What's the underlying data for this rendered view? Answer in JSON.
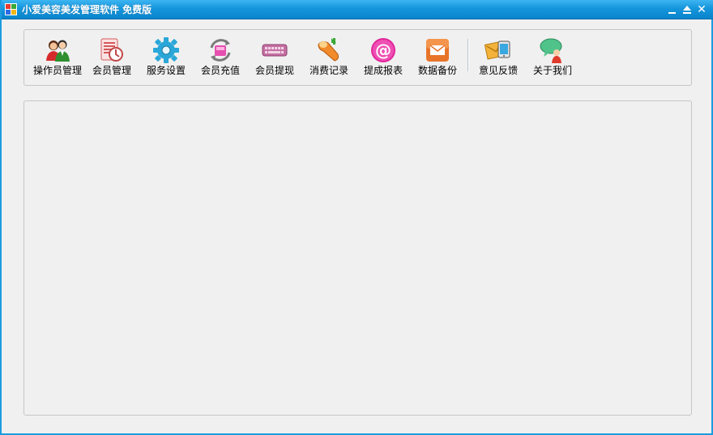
{
  "window": {
    "title": "小爱美容美发管理软件 免费版",
    "controls": {
      "minimize": "_",
      "maximize": "▲",
      "close": "✕"
    }
  },
  "toolbar": {
    "items": [
      {
        "label": "操作员管理",
        "icon": "operators-icon"
      },
      {
        "label": "会员管理",
        "icon": "member-card-icon"
      },
      {
        "label": "服务设置",
        "icon": "gear-icon"
      },
      {
        "label": "会员充值",
        "icon": "recharge-icon"
      },
      {
        "label": "会员提现",
        "icon": "keyboard-icon"
      },
      {
        "label": "消费记录",
        "icon": "record-icon"
      },
      {
        "label": "提成报表",
        "icon": "at-sign-icon"
      },
      {
        "label": "数据备份",
        "icon": "mail-icon"
      },
      {
        "label": "意见反馈",
        "icon": "feedback-icon"
      },
      {
        "label": "关于我们",
        "icon": "about-chat-icon"
      }
    ]
  },
  "colors": {
    "titlebar": "#1596dc",
    "background": "#f0f0f0",
    "border": "#c6c6c6"
  }
}
